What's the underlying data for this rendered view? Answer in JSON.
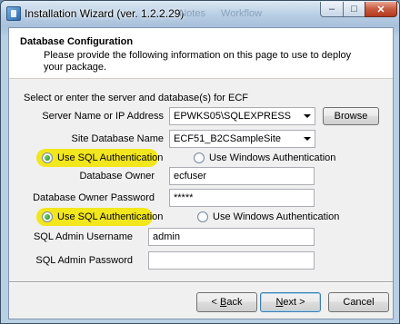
{
  "window": {
    "title": "Installation Wizard (ver. 1.2.2.29)",
    "bg_tabs": [
      "...",
      "Notes",
      "Workflow"
    ],
    "controls": {
      "minimize": "–",
      "maximize": "□",
      "close": "✕"
    }
  },
  "header": {
    "title": "Database Configuration",
    "description": "Please provide the following information on this page to use to deploy your package."
  },
  "form": {
    "intro": "Select or enter the server and database(s) for ECF",
    "server_label": "Server Name or IP Address",
    "server_value": "EPWKS05\\SQLEXPRESS",
    "browse_label": "Browse",
    "site_db_label": "Site Database Name",
    "site_db_value": "ECF51_B2CSampleSite",
    "auth1": {
      "sql_auth_label": "Use SQL Authentication",
      "windows_auth_label": "Use Windows Authentication",
      "owner_label": "Database Owner",
      "owner_value": "ecfuser",
      "owner_password_label": "Database Owner Password",
      "owner_password_value": "*****"
    },
    "auth2": {
      "sql_auth_label": "Use SQL Authentication",
      "windows_auth_label": "Use Windows Authentication",
      "admin_user_label": "SQL Admin Username",
      "admin_user_value": "admin",
      "admin_password_label": "SQL Admin Password",
      "admin_password_value": ""
    }
  },
  "footer": {
    "back": {
      "accel": "B",
      "rest": "ack",
      "prefix": "< "
    },
    "next": {
      "accel": "N",
      "rest": "ext",
      "suffix": " >"
    },
    "cancel": "Cancel"
  },
  "highlight_color": "#f2e61d"
}
